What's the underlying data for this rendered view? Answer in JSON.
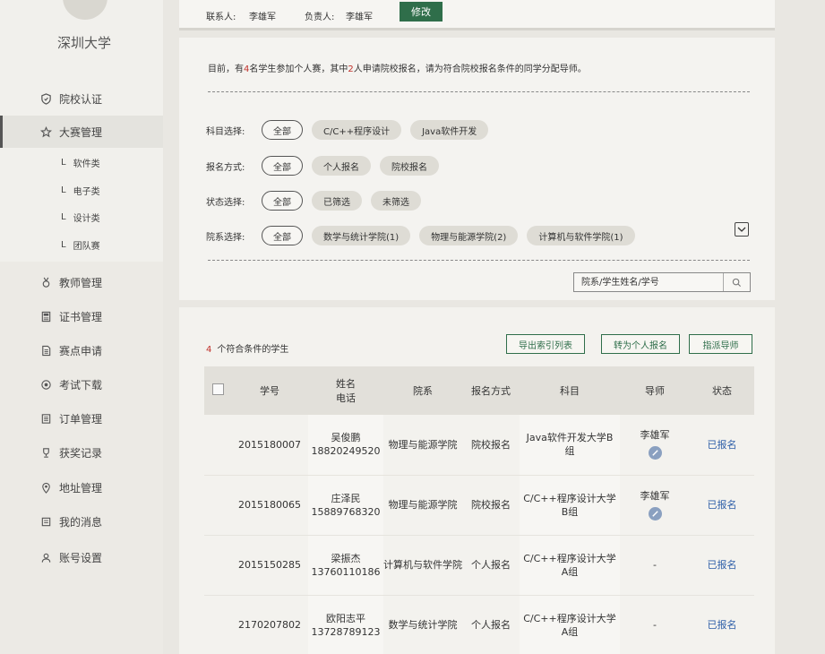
{
  "sidebar": {
    "school": "深圳大学",
    "items": [
      {
        "label": "院校认证",
        "icon": "shield-icon"
      },
      {
        "label": "大赛管理",
        "icon": "star-icon"
      },
      {
        "label": "教师管理",
        "icon": "medal-icon"
      },
      {
        "label": "证书管理",
        "icon": "certificate-icon"
      },
      {
        "label": "赛点申请",
        "icon": "document-icon"
      },
      {
        "label": "考试下载",
        "icon": "download-icon"
      },
      {
        "label": "订单管理",
        "icon": "order-icon"
      },
      {
        "label": "获奖记录",
        "icon": "trophy-icon"
      },
      {
        "label": "地址管理",
        "icon": "location-icon"
      },
      {
        "label": "我的消息",
        "icon": "message-icon"
      },
      {
        "label": "账号设置",
        "icon": "user-icon"
      }
    ],
    "sub_items": [
      {
        "prefix": "L",
        "label": "软件类"
      },
      {
        "prefix": "L",
        "label": "电子类"
      },
      {
        "prefix": "L",
        "label": "设计类"
      },
      {
        "prefix": "L",
        "label": "团队赛"
      }
    ]
  },
  "top": {
    "contact_label": "联系人:",
    "contact_name": "李雄军",
    "owner_label": "负责人:",
    "owner_name": "李雄军",
    "edit_button": "修改"
  },
  "notice": {
    "part1": "目前，有",
    "count1": "4",
    "part2": "名学生参加个人赛，其中",
    "count2": "2",
    "part3": "人申请院校报名，请为符合院校报名条件的同学分配导师。"
  },
  "filters": {
    "subject": {
      "label": "科目选择:",
      "options": [
        "全部",
        "C/C++程序设计",
        "Java软件开发"
      ]
    },
    "method": {
      "label": "报名方式:",
      "options": [
        "全部",
        "个人报名",
        "院校报名"
      ]
    },
    "status": {
      "label": "状态选择:",
      "options": [
        "全部",
        "已筛选",
        "未筛选"
      ]
    },
    "department": {
      "label": "院系选择:",
      "options": [
        "全部",
        "数学与统计学院(1)",
        "物理与能源学院(2)",
        "计算机与软件学院(1)"
      ]
    }
  },
  "search": {
    "placeholder": "院系/学生姓名/学号"
  },
  "list": {
    "count": "4",
    "count_text": "个符合条件的学生",
    "export_button": "导出索引列表",
    "to_personal_button": "转为个人报名",
    "assign_button": "指派导师",
    "headers": {
      "id": "学号",
      "name": "姓名",
      "phone": "电话",
      "dept": "院系",
      "method": "报名方式",
      "subject": "科目",
      "mentor": "导师",
      "status": "状态"
    },
    "rows": [
      {
        "id": "2015180007",
        "name": "吴俊鹏",
        "phone": "18820249520",
        "dept": "物理与能源学院",
        "method": "院校报名",
        "subject_l1": "Java软件开发大学B",
        "subject_l2": "组",
        "mentor": "李雄军",
        "status": "已报名"
      },
      {
        "id": "2015180065",
        "name": "庄泽民",
        "phone": "15889768320",
        "dept": "物理与能源学院",
        "method": "院校报名",
        "subject_l1": "C/C++程序设计大学",
        "subject_l2": "B组",
        "mentor": "李雄军",
        "status": "已报名"
      },
      {
        "id": "2015150285",
        "name": "梁振杰",
        "phone": "13760110186",
        "dept": "计算机与软件学院",
        "method": "个人报名",
        "subject_l1": "C/C++程序设计大学",
        "subject_l2": "A组",
        "mentor": "-",
        "status": "已报名"
      },
      {
        "id": "2170207802",
        "name": "欧阳志平",
        "phone": "13728789123",
        "dept": "数学与统计学院",
        "method": "个人报名",
        "subject_l1": "C/C++程序设计大学",
        "subject_l2": "A组",
        "mentor": "-",
        "status": "已报名"
      }
    ]
  }
}
